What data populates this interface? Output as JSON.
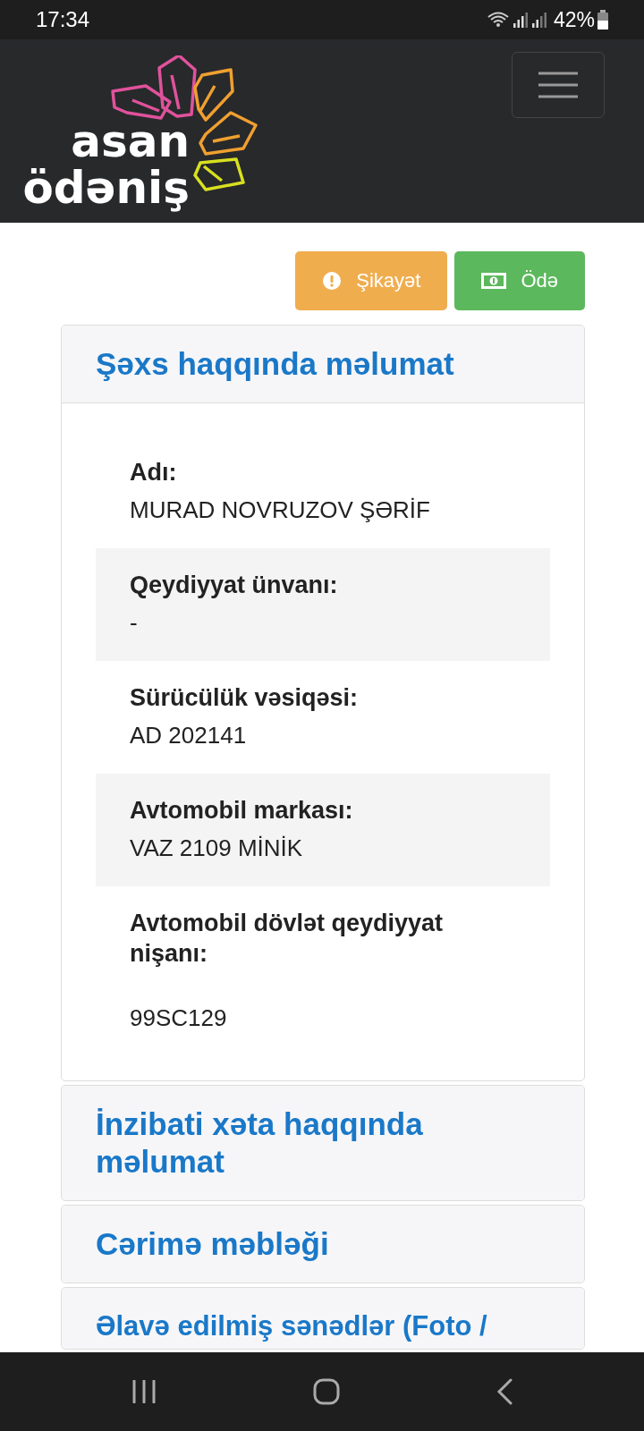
{
  "status_bar": {
    "time": "17:34",
    "battery": "42%"
  },
  "header": {
    "logo_lines": [
      "asan",
      "ödəniş"
    ]
  },
  "actions": [
    {
      "kind": "warning",
      "label": "Şikayət"
    },
    {
      "kind": "success",
      "label": "Ödə"
    }
  ],
  "sections": [
    {
      "title": "Şəxs haqqında məlumat",
      "expanded": true,
      "fields": [
        {
          "label": "Adı:",
          "value": "MURAD NOVRUZOV ŞƏRİF"
        },
        {
          "label": "Qeydiyyat ünvanı:",
          "value": "-"
        },
        {
          "label": "Sürücülük vəsiqəsi:",
          "value": "AD 202141"
        },
        {
          "label": "Avtomobil markası:",
          "value": "VAZ 2109 MİNİK"
        },
        {
          "label": "Avtomobil dövlət qeydiyyat nişanı:",
          "value": "99SC129"
        }
      ]
    },
    {
      "title": "İnzibati xəta haqqında məlumat",
      "expanded": false
    },
    {
      "title": "Cərimə məbləği",
      "expanded": false
    },
    {
      "title": "Əlavə edilmiş sənədlər (Foto /",
      "expanded": false
    }
  ]
}
